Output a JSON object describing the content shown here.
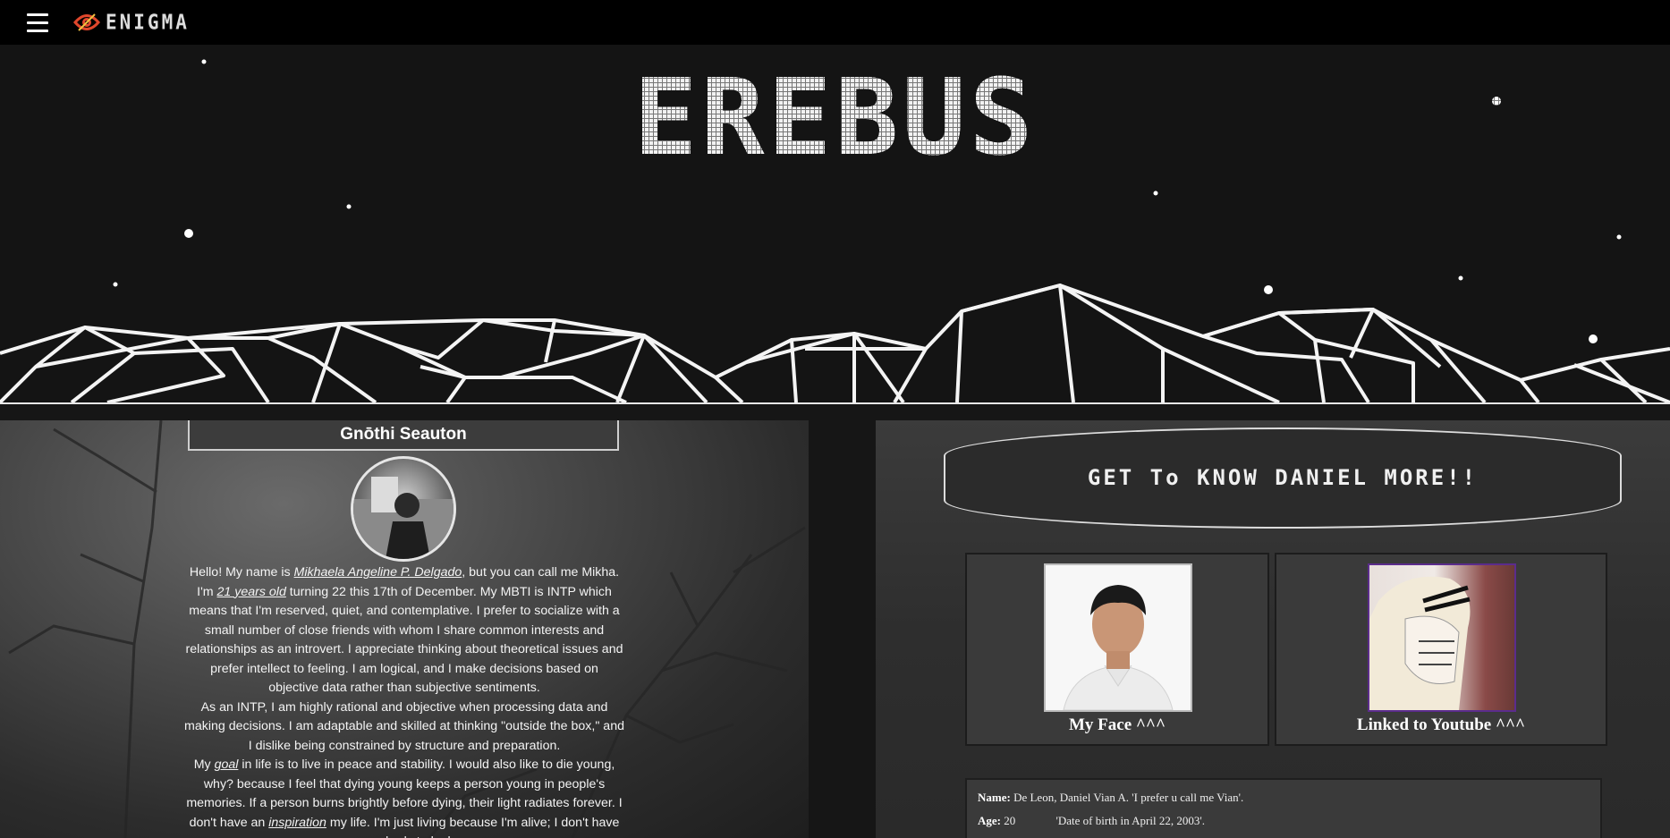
{
  "topbar": {
    "brand": "ENIGMA"
  },
  "hero": {
    "title": "EREBUS"
  },
  "about": {
    "title": "Gnōthi Seauton",
    "bio": {
      "p1_a": "Hello! My name is ",
      "p1_name": "Mikhaela Angeline P. Delgado",
      "p1_b": ", but you can call me Mikha. I'm ",
      "p1_age": "21 years old",
      "p1_c": " turning 22 this 17th of December. My MBTI is INTP which means that I'm reserved, quiet, and contemplative. I prefer to socialize with a small number of close friends with whom I share common interests and relationships as an introvert. I appreciate thinking about theoretical issues and prefer intellect to feeling. I am logical, and I make decisions based on objective data rather than subjective sentiments.",
      "p2": "As an INTP, I am highly rational and objective when processing data and making decisions. I am adaptable and skilled at thinking \"outside the box,\" and I dislike being constrained by structure and preparation.",
      "p3_a": "My ",
      "p3_goal": "goal",
      "p3_b": " in life is to live in peace and stability. I would also like to die young, why? because I feel that dying young keeps a person young in people's memories. If a person burns brightly before dying, their light radiates forever. I don't have an ",
      "p3_insp": "inspiration",
      "p3_c": " my life. I'm just living because I'm alive; I don't have somebody to look"
    }
  },
  "daniel": {
    "banner": "GET To KNOW DANIEL MORE!!",
    "face_caption": "My Face ^^^",
    "yt_caption": "Linked to Youtube ^^^",
    "info": {
      "name_label": "Name:",
      "name_value": "De Leon, Daniel Vian A. 'I prefer u call me Vian'.",
      "age_label": "Age:",
      "age_value": "20",
      "age_note": "'Date of birth in April 22, 2003'."
    }
  },
  "colors": {
    "topbar": "#000000",
    "logo_accent": "#e0472c",
    "hero_bg": "#141414",
    "yt_border": "#5b2c8c"
  }
}
